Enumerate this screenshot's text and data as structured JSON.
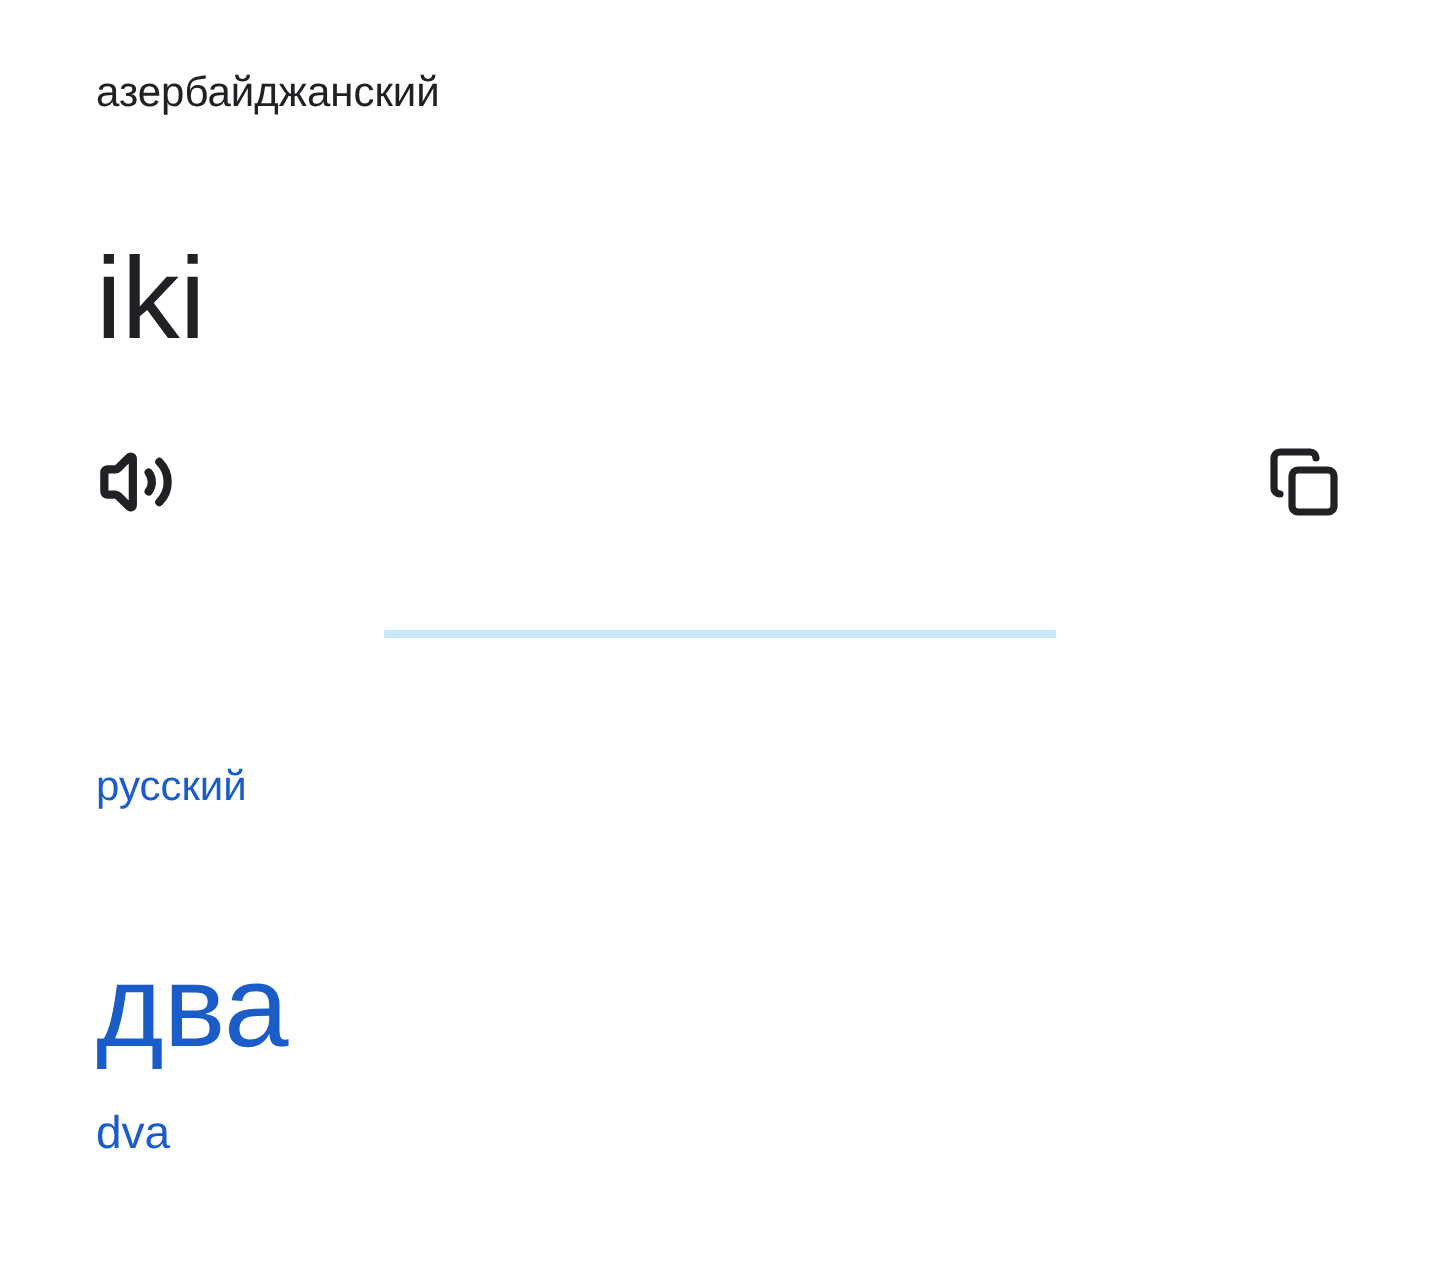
{
  "source": {
    "language": "азербайджанский",
    "text": "iki"
  },
  "target": {
    "language": "русский",
    "text": "два",
    "transliteration": "dva"
  }
}
